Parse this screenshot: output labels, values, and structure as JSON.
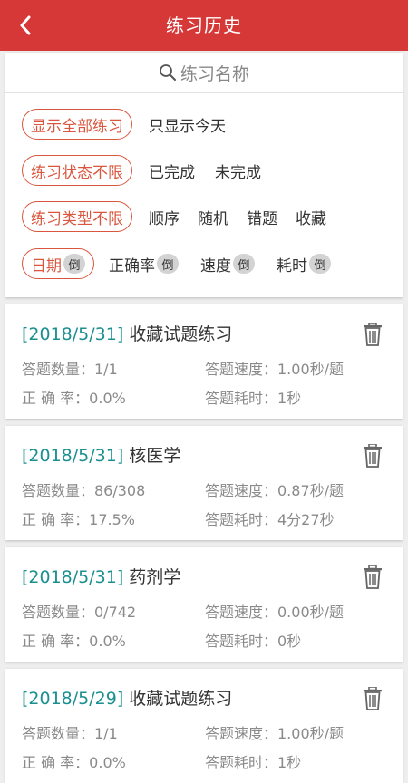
{
  "header": {
    "title": "练习历史",
    "back_icon": "chevron-left-icon",
    "background": "#d63838"
  },
  "search": {
    "placeholder": "练习名称",
    "icon": "search-icon"
  },
  "filters": {
    "scope": {
      "active": "显示全部练习",
      "options": [
        "只显示今天"
      ]
    },
    "status": {
      "active": "练习状态不限",
      "options": [
        "已完成",
        "未完成"
      ]
    },
    "type": {
      "active": "练习类型不限",
      "options": [
        "顺序",
        "随机",
        "错题",
        "收藏"
      ]
    },
    "sort": {
      "active": "日期",
      "active_badge": "倒",
      "options": [
        {
          "label": "正确率",
          "badge": "倒"
        },
        {
          "label": "速度",
          "badge": "倒"
        },
        {
          "label": "耗时",
          "badge": "倒"
        }
      ]
    },
    "accent": "#d9573f"
  },
  "records": [
    {
      "date": "[2018/5/31]",
      "name": "收藏试题练习",
      "count": "答题数量：1/1",
      "speed": "答题速度：1.00秒/题",
      "accuracy": "正 确 率：0.0%",
      "time": "答题耗时：1秒"
    },
    {
      "date": "[2018/5/31]",
      "name": "核医学",
      "count": "答题数量：86/308",
      "speed": "答题速度：0.87秒/题",
      "accuracy": "正 确 率：17.5%",
      "time": "答题耗时：4分27秒"
    },
    {
      "date": "[2018/5/31]",
      "name": "药剂学",
      "count": "答题数量：0/742",
      "speed": "答题速度：0.00秒/题",
      "accuracy": "正 确 率：0.0%",
      "time": "答题耗时：0秒"
    },
    {
      "date": "[2018/5/29]",
      "name": "收藏试题练习",
      "count": "答题数量：1/1",
      "speed": "答题速度：1.00秒/题",
      "accuracy": "正 确 率：0.0%",
      "time": "答题耗时：1秒"
    }
  ],
  "record_date_color": "#1a8f8f",
  "delete_icon": "trash-icon"
}
